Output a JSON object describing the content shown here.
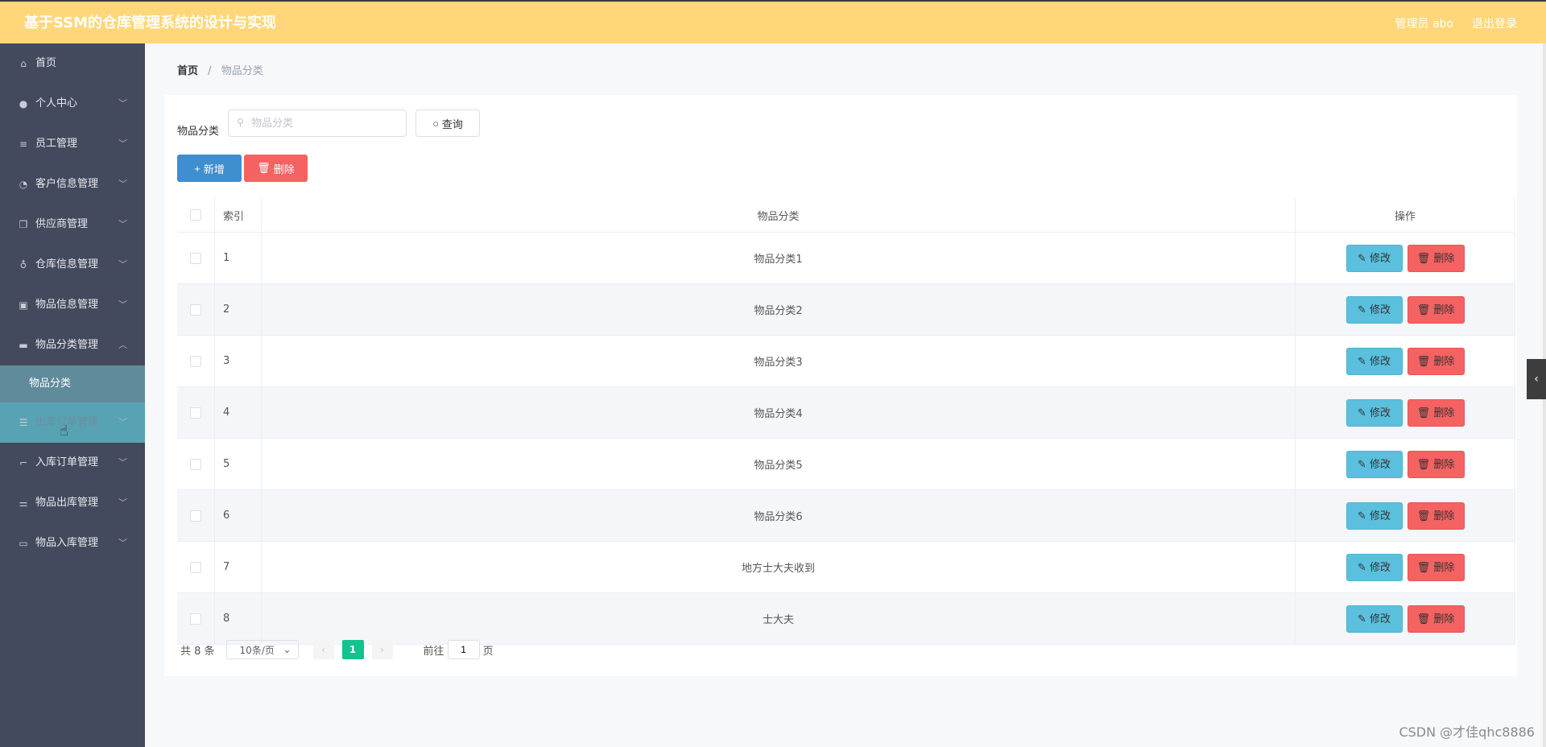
{
  "header": {
    "title": "基于SSM的仓库管理系统的设计与实现",
    "user": "管理员 abo",
    "logout": "退出登录"
  },
  "sidebar": {
    "items": [
      {
        "label": "首页",
        "icon": "home-icon",
        "has_children": false
      },
      {
        "label": "个人中心",
        "icon": "user-icon",
        "has_children": true
      },
      {
        "label": "员工管理",
        "icon": "menu-lines-icon",
        "has_children": true
      },
      {
        "label": "客户信息管理",
        "icon": "dashboard-icon",
        "has_children": true
      },
      {
        "label": "供应商管理",
        "icon": "copy-icon",
        "has_children": true
      },
      {
        "label": "仓库信息管理",
        "icon": "microphone-icon",
        "has_children": true
      },
      {
        "label": "物品信息管理",
        "icon": "clipboard-icon",
        "has_children": true
      },
      {
        "label": "物品分类管理",
        "icon": "briefcase-icon",
        "has_children": true,
        "expanded": true,
        "children": [
          {
            "label": "物品分类",
            "active": true
          }
        ]
      },
      {
        "label": "出库订单管理",
        "icon": "list-icon",
        "has_children": true,
        "hovered": true
      },
      {
        "label": "入库订单管理",
        "icon": "crop-icon",
        "has_children": true
      },
      {
        "label": "物品出库管理",
        "icon": "sliders-icon",
        "has_children": true
      },
      {
        "label": "物品入库管理",
        "icon": "monitor-icon",
        "has_children": true
      }
    ]
  },
  "breadcrumb": {
    "home": "首页",
    "current": "物品分类"
  },
  "search": {
    "label": "物品分类",
    "placeholder": "物品分类",
    "value": "",
    "button": "查询"
  },
  "actions": {
    "add": "新增",
    "delete": "删除"
  },
  "table": {
    "headers": {
      "index": "索引",
      "name": "物品分类",
      "ops": "操作"
    },
    "edit_label": "修改",
    "delete_label": "删除",
    "rows": [
      {
        "index": "1",
        "name": "物品分类1"
      },
      {
        "index": "2",
        "name": "物品分类2"
      },
      {
        "index": "3",
        "name": "物品分类3"
      },
      {
        "index": "4",
        "name": "物品分类4"
      },
      {
        "index": "5",
        "name": "物品分类5"
      },
      {
        "index": "6",
        "name": "物品分类6"
      },
      {
        "index": "7",
        "name": "地方士大夫收到"
      },
      {
        "index": "8",
        "name": "士大夫"
      }
    ]
  },
  "pagination": {
    "total": "共 8 条",
    "page_size": "10条/页",
    "current_page": "1",
    "goto_prefix": "前往",
    "goto_value": "1",
    "goto_suffix": "页"
  },
  "watermark": "CSDN @才佳qhc8886",
  "colors": {
    "header_bg": "#ffd77a",
    "sidebar_bg": "#434a5d",
    "primary": "#3e8ed0",
    "danger": "#f56262",
    "info": "#5bc0de",
    "page_active": "#13c28d"
  }
}
